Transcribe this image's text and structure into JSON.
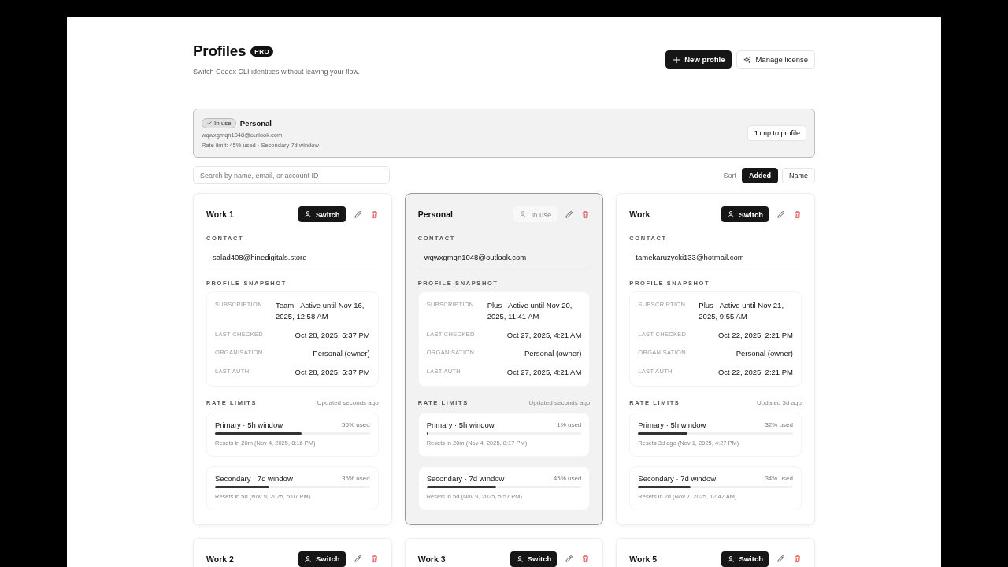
{
  "header": {
    "title": "Profiles",
    "badge": "PRO",
    "subtitle": "Switch Codex CLI identities without leaving your flow.",
    "buttons": [
      {
        "kind": "primary",
        "label": "New profile"
      },
      {
        "kind": "secondary",
        "label": "Manage license"
      }
    ]
  },
  "current": {
    "status": "In use",
    "name": "Personal",
    "email": "wqwxgmqn1048@outlook.com",
    "rate": "Rate limit: 45% used · Secondary 7d window",
    "button": "Jump to profile"
  },
  "search": {
    "placeholder": "Search by name, email, or account ID"
  },
  "sort": {
    "label": "Sort",
    "options": [
      {
        "label": "Added",
        "selected": true
      },
      {
        "label": "Name",
        "selected": false
      }
    ]
  },
  "cards": [
    {
      "name": "Work 1",
      "in_use": false,
      "action": "Switch",
      "contact_label": "CONTACT",
      "contact": "salad408@hinedigitals.store",
      "snapshot_label": "PROFILE SNAPSHOT",
      "snapshot": [
        {
          "label": "SUBSCRIPTION",
          "value": "Team · Active until Nov 16, 2025, 12:58 AM"
        },
        {
          "label": "LAST CHECKED",
          "value": "Oct 28, 2025, 5:37 PM"
        },
        {
          "label": "ORGANISATION",
          "value": "Personal (owner)"
        },
        {
          "label": "LAST AUTH",
          "value": "Oct 28, 2025, 5:37 PM"
        }
      ],
      "limits_label": "RATE LIMITS",
      "updated": "Updated seconds ago",
      "limits": [
        {
          "name": "Primary · 5h window",
          "used": "56% used",
          "level": 0.56,
          "resets": "Resets in 20m (Nov 4, 2025, 8:16 PM)"
        },
        {
          "name": "Secondary · 7d window",
          "used": "35% used",
          "level": 0.35,
          "resets": "Resets in 5d (Nov 9, 2025, 5:07 PM)"
        }
      ]
    },
    {
      "name": "Personal",
      "in_use": true,
      "action": "In use",
      "contact_label": "CONTACT",
      "contact": "wqwxgmqn1048@outlook.com",
      "snapshot_label": "PROFILE SNAPSHOT",
      "snapshot": [
        {
          "label": "SUBSCRIPTION",
          "value": "Plus · Active until Nov 20, 2025, 11:41 AM"
        },
        {
          "label": "LAST CHECKED",
          "value": "Oct 27, 2025, 4:21 AM"
        },
        {
          "label": "ORGANISATION",
          "value": "Personal (owner)"
        },
        {
          "label": "LAST AUTH",
          "value": "Oct 27, 2025, 4:21 AM"
        }
      ],
      "limits_label": "RATE LIMITS",
      "updated": "Updated seconds ago",
      "limits": [
        {
          "name": "Primary · 5h window",
          "used": "1% used",
          "level": 0.01,
          "resets": "Resets in 20m (Nov 4, 2025, 8:17 PM)"
        },
        {
          "name": "Secondary · 7d window",
          "used": "45% used",
          "level": 0.45,
          "resets": "Resets in 5d (Nov 9, 2025, 5:57 PM)"
        }
      ]
    },
    {
      "name": "Work",
      "in_use": false,
      "action": "Switch",
      "contact_label": "CONTACT",
      "contact": "tamekaruzycki133@hotmail.com",
      "snapshot_label": "PROFILE SNAPSHOT",
      "snapshot": [
        {
          "label": "SUBSCRIPTION",
          "value": "Plus · Active until Nov 21, 2025, 9:55 AM"
        },
        {
          "label": "LAST CHECKED",
          "value": "Oct 22, 2025, 2:21 PM"
        },
        {
          "label": "ORGANISATION",
          "value": "Personal (owner)"
        },
        {
          "label": "LAST AUTH",
          "value": "Oct 22, 2025, 2:21 PM"
        }
      ],
      "limits_label": "RATE LIMITS",
      "updated": "Updated 3d ago",
      "limits": [
        {
          "name": "Primary · 5h window",
          "used": "32% used",
          "level": 0.32,
          "resets": "Resets 3d ago (Nov 1, 2025, 4:27 PM)"
        },
        {
          "name": "Secondary · 7d window",
          "used": "34% used",
          "level": 0.34,
          "resets": "Resets in 2d (Nov 7, 2025, 12:42 AM)"
        }
      ]
    },
    {
      "name": "Work 2",
      "in_use": false,
      "action": "Switch"
    },
    {
      "name": "Work 3",
      "in_use": false,
      "action": "Switch"
    },
    {
      "name": "Work 5",
      "in_use": false,
      "action": "Switch"
    }
  ]
}
